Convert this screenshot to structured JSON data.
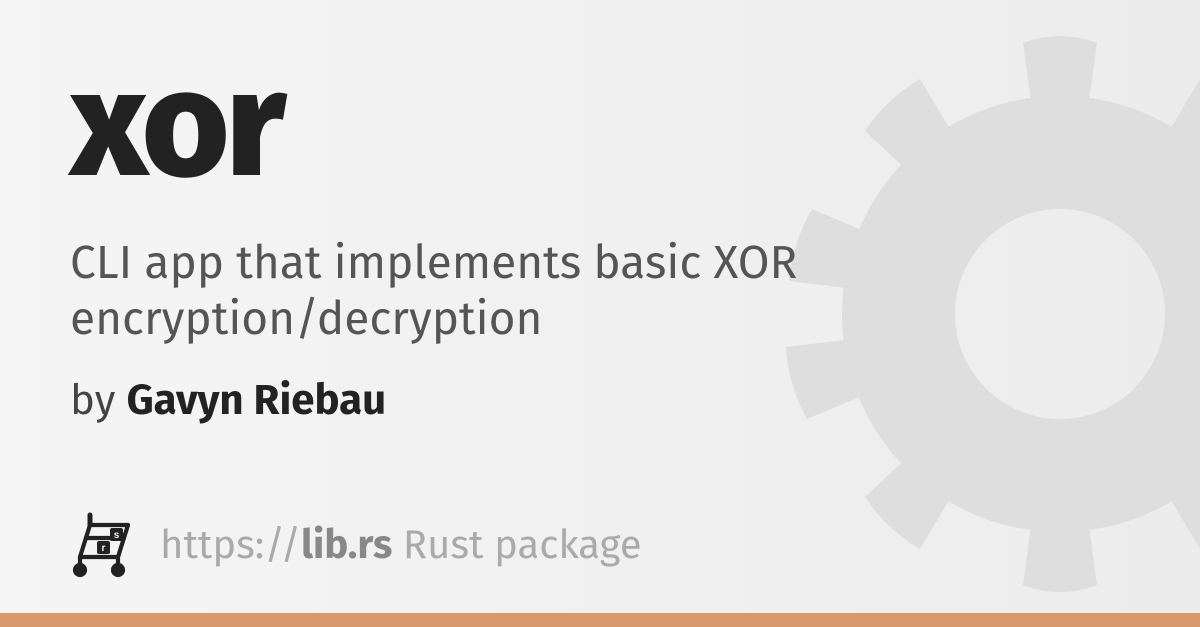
{
  "title": "xor",
  "description": "CLI app that implements basic XOR encryption/decryption",
  "byline_prefix": "by ",
  "author": "Gavyn Riebau",
  "url_prefix": "https://",
  "url_domain": "lib.rs",
  "url_suffix": " Rust package",
  "colors": {
    "accent": "#d89a6c"
  }
}
